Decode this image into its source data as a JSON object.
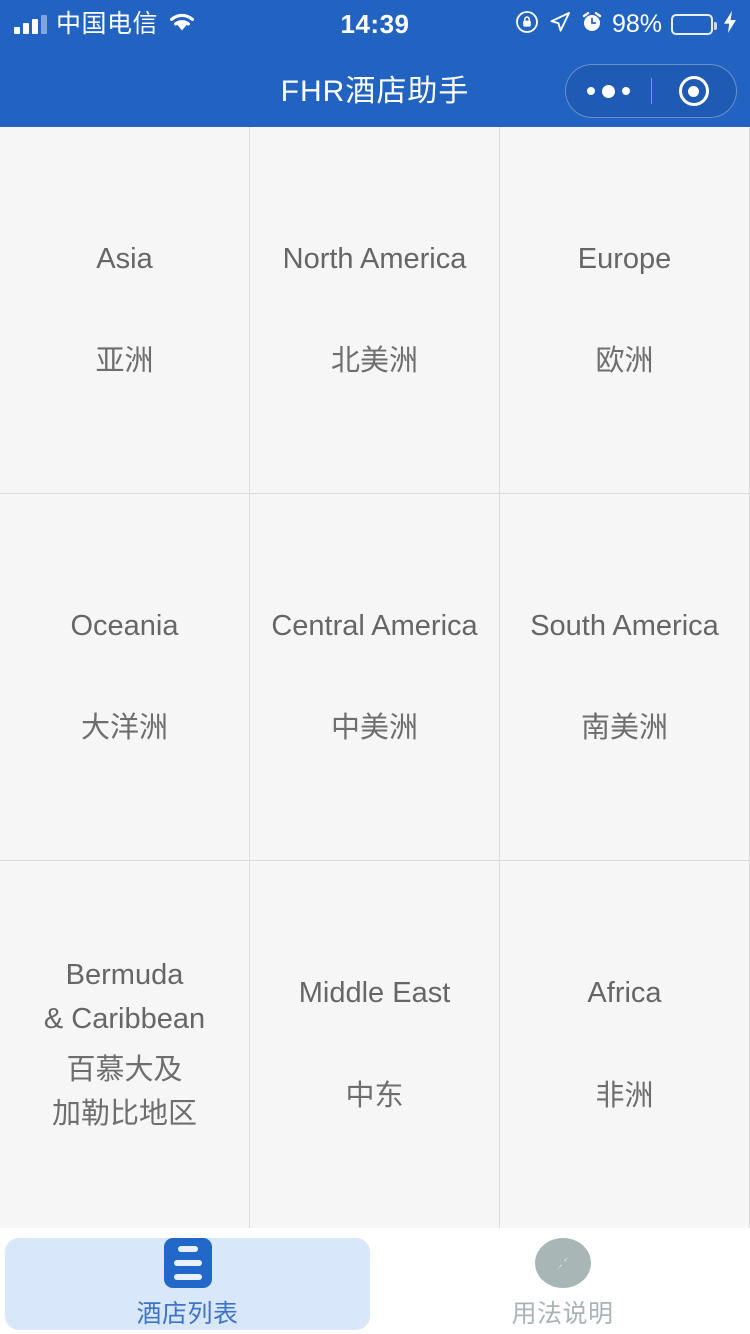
{
  "status_bar": {
    "carrier": "中国电信",
    "time": "14:39",
    "battery_percent": "98%",
    "icons": [
      "signal-bars-icon",
      "wifi-icon",
      "rotation-lock-icon",
      "location-arrow-icon",
      "alarm-clock-icon",
      "battery-icon",
      "charging-bolt-icon"
    ]
  },
  "nav_bar": {
    "title": "FHR酒店助手",
    "capsule": {
      "menu_icon": "more-dots-icon",
      "close_icon": "target-circle-icon"
    }
  },
  "grid": {
    "rows": [
      [
        {
          "en": "Asia",
          "zh": "亚洲"
        },
        {
          "en": "North America",
          "zh": "北美洲"
        },
        {
          "en": "Europe",
          "zh": "欧洲"
        }
      ],
      [
        {
          "en": "Oceania",
          "zh": "大洋洲"
        },
        {
          "en": "Central America",
          "zh": "中美洲"
        },
        {
          "en": "South America",
          "zh": "南美洲"
        }
      ],
      [
        {
          "en": "Bermuda\n& Caribbean",
          "zh": "百慕大及\n加勒比地区"
        },
        {
          "en": "Middle East",
          "zh": "中东"
        },
        {
          "en": "Africa",
          "zh": "非洲"
        }
      ]
    ]
  },
  "tab_bar": {
    "tabs": [
      {
        "label": "酒店列表",
        "icon": "list-document-icon",
        "active": true
      },
      {
        "label": "用法说明",
        "icon": "compass-icon",
        "active": false
      }
    ]
  },
  "colors": {
    "header_blue": "#2263c2",
    "capsule_blue": "#1f5ab4",
    "cell_bg": "#f6f6f6",
    "cell_border": "#dcdcdc",
    "cell_text": "#666666",
    "tab_active_bg": "#d9e7fa",
    "tab_active_text": "#3d73c8",
    "tab_inactive_text": "#a9b4b6",
    "battery_green": "#6fd06f"
  }
}
